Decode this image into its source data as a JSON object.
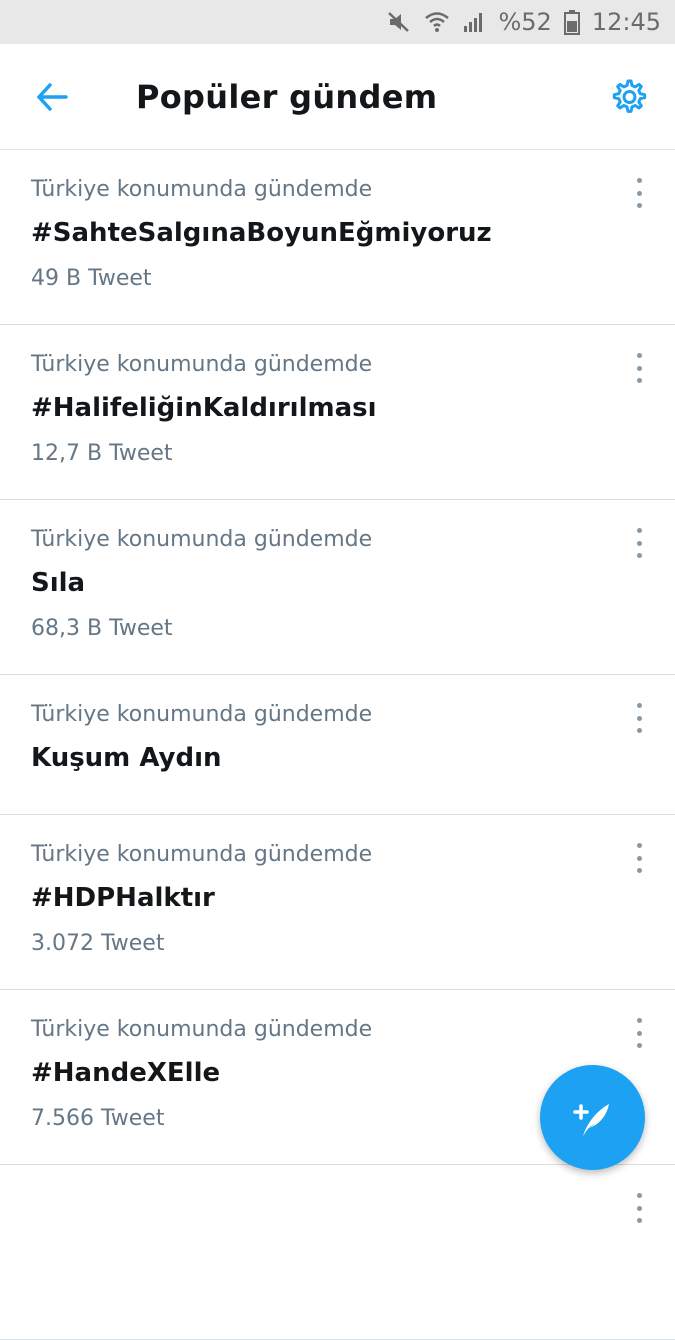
{
  "status_bar": {
    "battery": "%52",
    "time": "12:45",
    "icons": [
      "mute-icon",
      "wifi-icon",
      "signal-icon",
      "battery-icon"
    ]
  },
  "header": {
    "title": "Popüler gündem",
    "back_icon": "back-arrow-icon",
    "settings_icon": "gear-icon"
  },
  "trends": [
    {
      "context": "Türkiye konumunda gündemde",
      "name": "#SahteSalgınaBoyunEğmiyoruz",
      "count": "49 B Tweet"
    },
    {
      "context": "Türkiye konumunda gündemde",
      "name": "#HalifeliğinKaldırılması",
      "count": "12,7 B Tweet"
    },
    {
      "context": "Türkiye konumunda gündemde",
      "name": "Sıla",
      "count": "68,3 B Tweet"
    },
    {
      "context": "Türkiye konumunda gündemde",
      "name": "Kuşum Aydın",
      "count": ""
    },
    {
      "context": "Türkiye konumunda gündemde",
      "name": "#HDPHalktır",
      "count": "3.072 Tweet"
    },
    {
      "context": "Türkiye konumunda gündemde",
      "name": "#HandeXElle",
      "count": "7.566 Tweet"
    }
  ],
  "fab": {
    "icon": "compose-tweet-icon"
  },
  "colors": {
    "accent": "#1da1f2",
    "text_primary": "#14171a",
    "text_secondary": "#657786",
    "divider": "#d7dfe5",
    "status_bar_bg": "#e8e8e8"
  }
}
